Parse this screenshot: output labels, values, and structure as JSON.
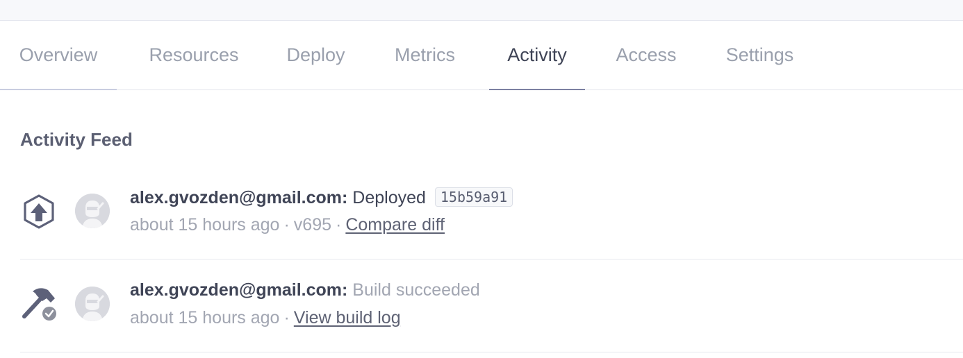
{
  "tabs": [
    {
      "label": "Overview",
      "active": false
    },
    {
      "label": "Resources",
      "active": false
    },
    {
      "label": "Deploy",
      "active": false
    },
    {
      "label": "Metrics",
      "active": false
    },
    {
      "label": "Activity",
      "active": true
    },
    {
      "label": "Access",
      "active": false
    },
    {
      "label": "Settings",
      "active": false
    }
  ],
  "feed": {
    "title": "Activity Feed",
    "items": [
      {
        "icon": "deploy-upload-hexagon-icon",
        "avatar": "user-avatar-icon",
        "user": "alex.gvozden@gmail.com:",
        "action": "Deployed",
        "commit": "15b59a91",
        "time": "about 15 hours ago",
        "separator": "·",
        "version": "v695",
        "link": "Compare diff"
      },
      {
        "icon": "build-hammer-check-icon",
        "avatar": "user-avatar-icon",
        "user": "alex.gvozden@gmail.com:",
        "action": "Build succeeded",
        "time": "about 15 hours ago",
        "separator": "·",
        "link": "View build log"
      }
    ]
  },
  "colors": {
    "active_tab": "#3f4456",
    "inactive_tab": "#9aa0ad",
    "muted_text": "#a2a6b2",
    "icon": "#5d6179",
    "success_badge": "#8d909c"
  }
}
